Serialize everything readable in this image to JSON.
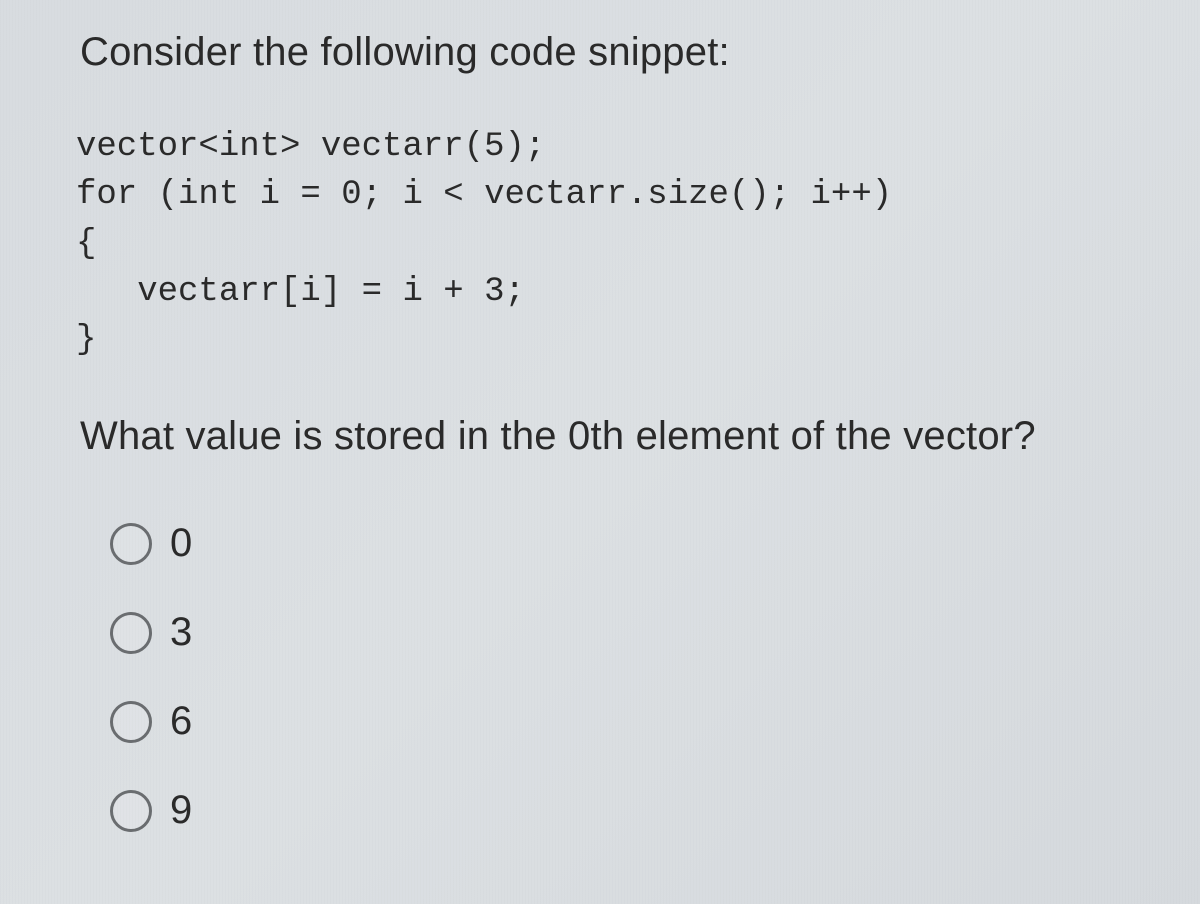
{
  "intro": "Consider the following code snippet:",
  "code": "vector<int> vectarr(5);\nfor (int i = 0; i < vectarr.size(); i++)\n{\n   vectarr[i] = i + 3;\n}",
  "question": "What value is stored in the 0th element of the vector?",
  "options": [
    {
      "label": "0"
    },
    {
      "label": "3"
    },
    {
      "label": "6"
    },
    {
      "label": "9"
    }
  ]
}
